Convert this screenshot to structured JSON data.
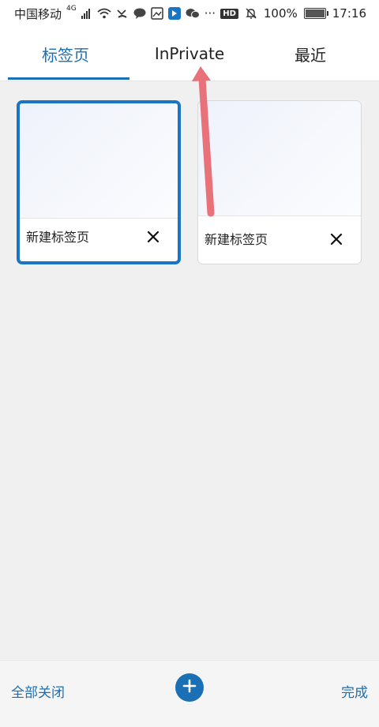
{
  "status_bar": {
    "carrier": "中国移动",
    "network": "4G",
    "battery_percent": "100%",
    "time": "17:16",
    "hd": "HD",
    "more": "···"
  },
  "tabs": [
    {
      "label": "标签页",
      "active": true
    },
    {
      "label": "InPrivate",
      "active": false
    },
    {
      "label": "最近",
      "active": false
    }
  ],
  "cards": [
    {
      "title": "新建标签页",
      "selected": true
    },
    {
      "title": "新建标签页",
      "selected": false
    }
  ],
  "bottom": {
    "close_all": "全部关闭",
    "done": "完成"
  },
  "colors": {
    "accent": "#1a6fb5",
    "annotation_arrow": "#e8717a"
  },
  "icons": {
    "close": "close-icon",
    "add": "plus-icon"
  }
}
